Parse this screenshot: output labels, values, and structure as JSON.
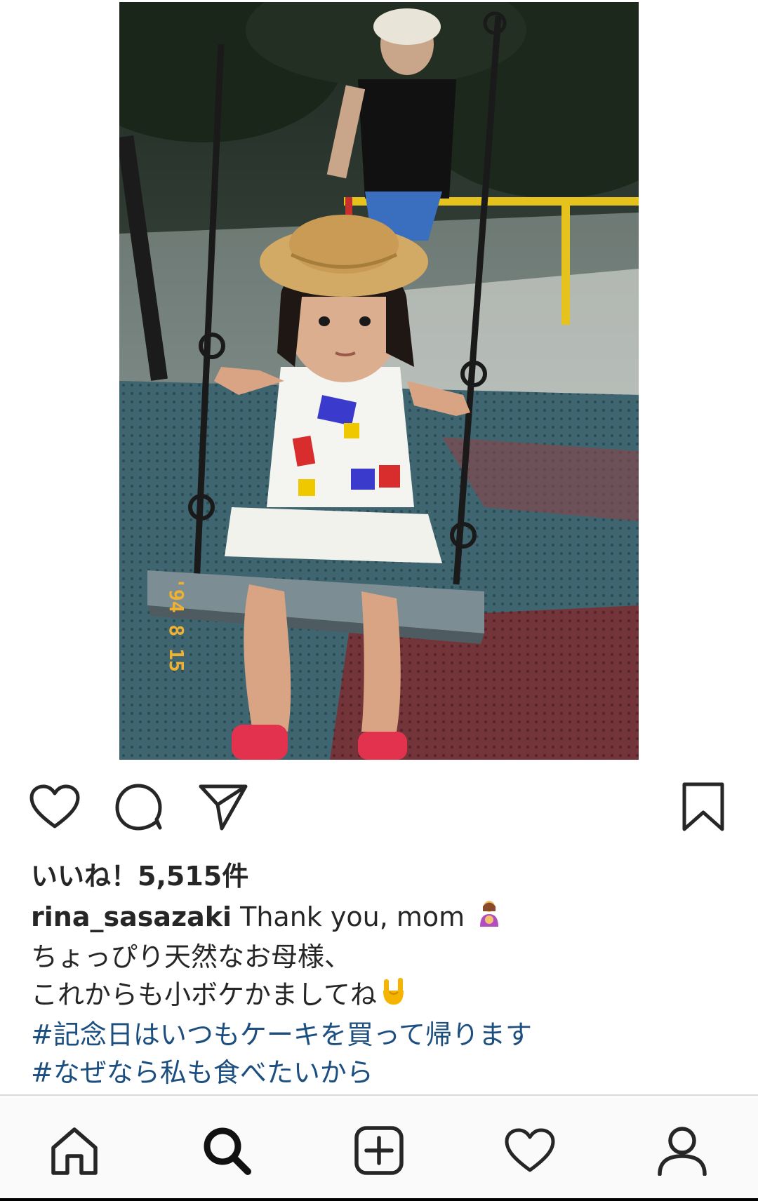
{
  "post": {
    "image_alt": "Photo of a young child in a straw hat sitting on a playground swing",
    "photo_date_stamp": "'94 8 15",
    "likes_text": "いいね！5,515件",
    "caption": {
      "username": "rina_sasazaki",
      "line1_text": "Thank you, mom",
      "line1_emoji": "woman-with-baby-emoji",
      "line2": "ちょっぴり天然なお母様、",
      "line3_text": "これからも小ボケかましてね",
      "line3_emoji": "sign-of-horns-emoji",
      "hashtag1": "#記念日はいつもケーキを買って帰ります",
      "hashtag2": "#なぜなら私も食べたいから"
    }
  },
  "actions": {
    "icons": [
      "heart-icon",
      "comment-icon",
      "share-icon",
      "bookmark-icon"
    ]
  },
  "bottom_nav": {
    "icons": [
      "home-icon",
      "search-icon",
      "add-post-icon",
      "activity-heart-icon",
      "profile-icon"
    ],
    "active": "search"
  },
  "colors": {
    "text": "#262626",
    "hashtag": "#1c4f80",
    "nav_background": "#fafafa",
    "divider": "#dbdbdb"
  }
}
